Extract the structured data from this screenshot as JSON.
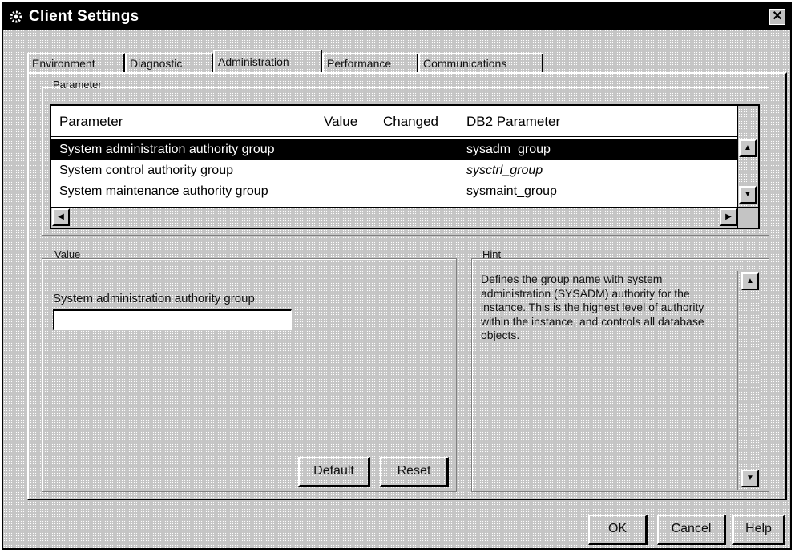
{
  "window": {
    "title": "Client Settings",
    "close_glyph": "✕",
    "icon": "gear-icon"
  },
  "tabs": [
    {
      "label": "Environment",
      "active": false
    },
    {
      "label": "Diagnostic",
      "active": false
    },
    {
      "label": "Administration",
      "active": true
    },
    {
      "label": "Performance",
      "active": false
    },
    {
      "label": "Communications",
      "active": false
    }
  ],
  "parameter_group": {
    "label": "Parameter",
    "columns": [
      "Parameter",
      "Value",
      "Changed",
      "DB2 Parameter"
    ],
    "rows": [
      {
        "parameter": "System administration authority group",
        "value": "",
        "changed": "",
        "db2_parameter": "sysadm_group",
        "selected": true
      },
      {
        "parameter": "System control authority group",
        "value": "",
        "changed": "",
        "db2_parameter": "sysctrl_group",
        "selected": false
      },
      {
        "parameter": "System maintenance authority group",
        "value": "",
        "changed": "",
        "db2_parameter": "sysmaint_group",
        "selected": false
      }
    ]
  },
  "value_group": {
    "label": "Value",
    "field_label": "System administration authority group",
    "field_value": "",
    "default_button": "Default",
    "reset_button": "Reset"
  },
  "hint_group": {
    "label": "Hint",
    "text": "Defines the group name with system administration (SYSADM) authority for the instance.  This is the highest level of authority within the instance, and controls all database objects."
  },
  "dialog_buttons": {
    "ok": "OK",
    "cancel": "Cancel",
    "help": "Help"
  },
  "colors": {
    "face": "#c4c4c4",
    "title_bar": "#000000",
    "selection": "#000000"
  }
}
